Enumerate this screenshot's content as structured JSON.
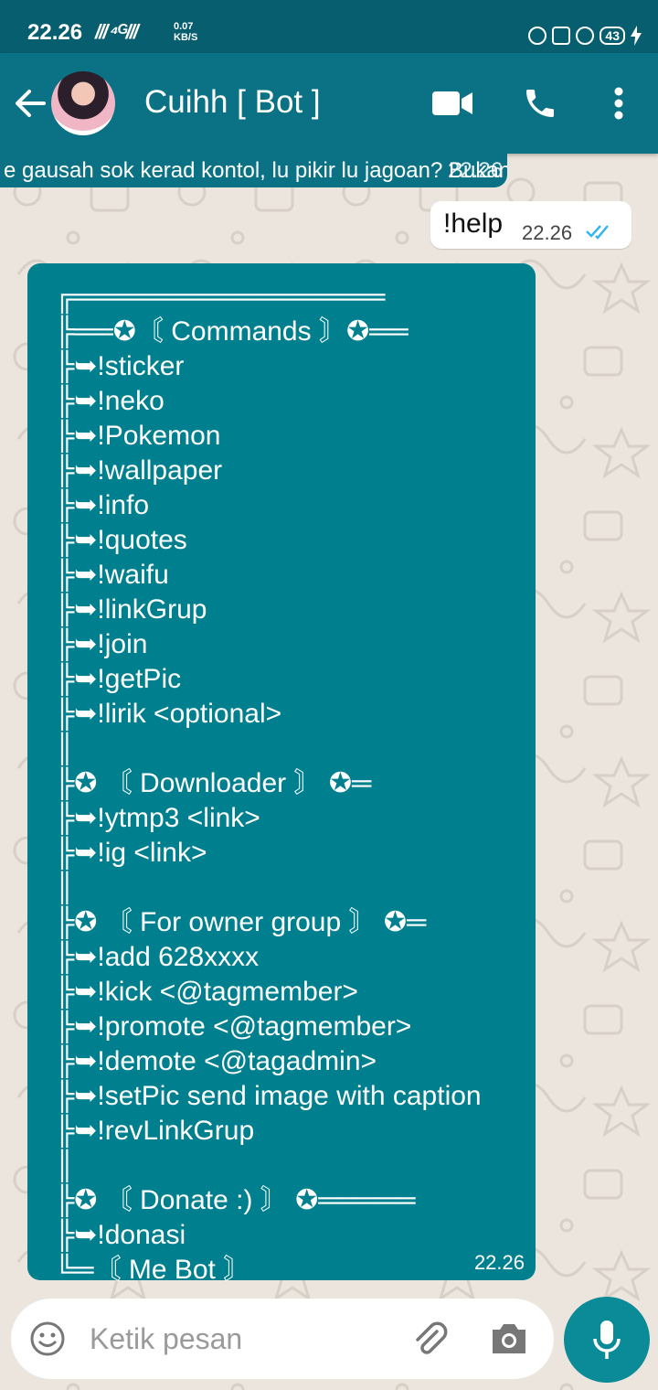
{
  "status_bar": {
    "time": "22.26",
    "network": "/// ⁴ᴳ///",
    "speed_value": "0.07",
    "speed_unit": "KB/S",
    "battery": "43"
  },
  "header": {
    "contact_name": "Cuihh [ Bot ]",
    "icons": [
      "back-arrow-icon",
      "video-call-icon",
      "phone-icon",
      "more-vert-icon"
    ]
  },
  "messages": {
    "quoted_text": "e gausah sok kerad kontol, lu pikir lu jagoan? Bukan ajg",
    "quoted_time": "22.26",
    "outgoing": {
      "text": "!help",
      "time": "22.26",
      "status": "read"
    },
    "incoming": {
      "time": "22.26",
      "lines": [
        "╔════════════════",
        "╠══✪〘 Commands 〙✪══",
        "╠➥!sticker",
        "╠➥!neko",
        "╠➥!Pokemon",
        "╠➥!wallpaper",
        "╠➥!info",
        "╠➥!quotes",
        "╠➥!waifu",
        "╠➥!linkGrup",
        "╠➥!join",
        "╠➥!getPic",
        "╠➥!lirik <optional>",
        "║",
        "╠✪ 〘 Downloader 〙 ✪═",
        "╠➥!ytmp3 <link>",
        "╠➥!ig <link>",
        "║",
        "╠✪ 〘 For owner group 〙 ✪═",
        "╠➥!add 628xxxx",
        "╠➥!kick <@tagmember>",
        "╠➥!promote <@tagmember>",
        "╠➥!demote <@tagadmin>",
        "╠➥!setPic send image with caption",
        "╠➥!revLinkGrup",
        "║",
        "╠✪ 〘 Donate :) 〙 ✪═════",
        "╠➥!donasi",
        "╚═〘 Me Bot 〙"
      ]
    }
  },
  "composer": {
    "placeholder": "Ketik pesan",
    "icons": [
      "emoji-icon",
      "attach-icon",
      "camera-icon",
      "mic-icon"
    ]
  },
  "colors": {
    "header": "#0b7285",
    "bubble_in": "#00808f",
    "bubble_out": "#ffffff",
    "read_ticks": "#34b7f1",
    "wallpaper": "#ece5dd"
  }
}
